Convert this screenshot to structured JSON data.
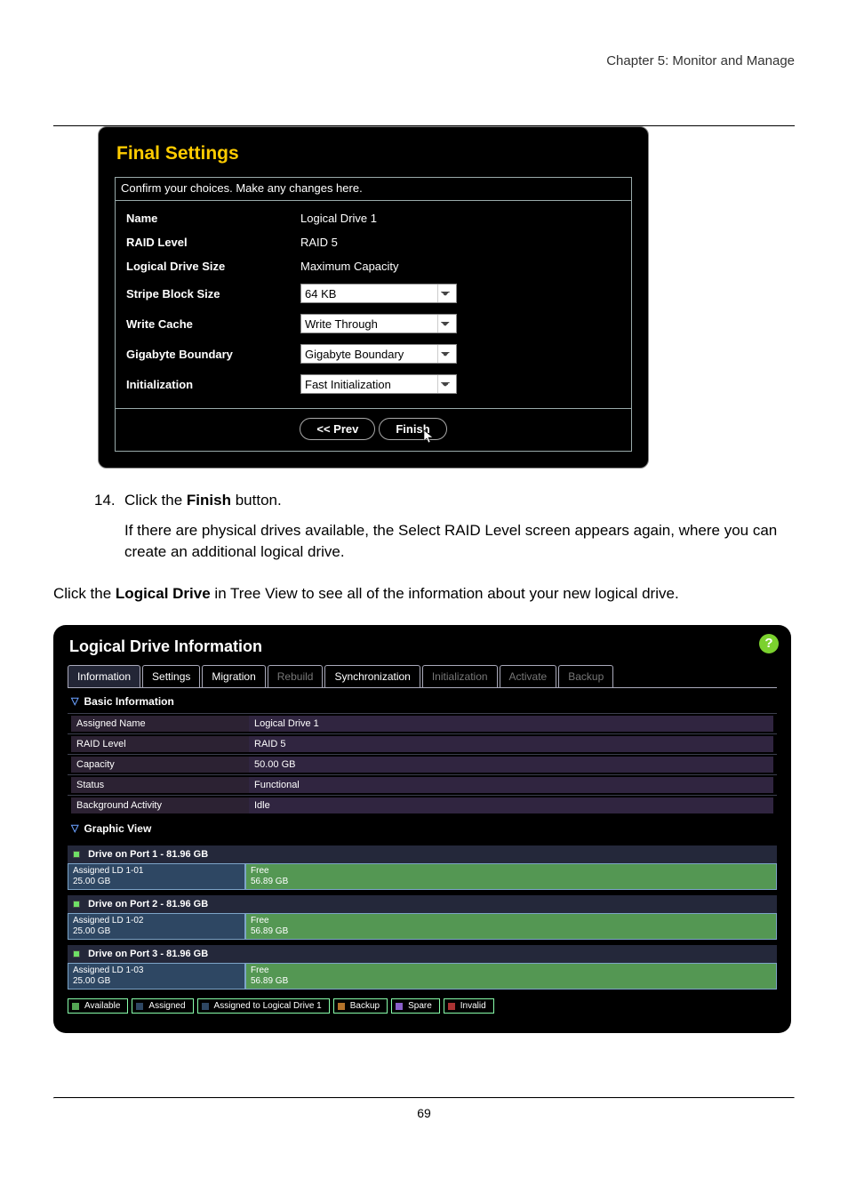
{
  "header": {
    "chapter": "Chapter 5: Monitor and Manage"
  },
  "figure1": {
    "title": "Final Settings",
    "instructions": "Confirm your choices. Make any changes here.",
    "rows": {
      "name_label": "Name",
      "name_value": "Logical Drive 1",
      "raid_label": "RAID Level",
      "raid_value": "RAID 5",
      "size_label": "Logical Drive Size",
      "size_value": "Maximum Capacity",
      "stripe_label": "Stripe Block Size",
      "stripe_value": "64 KB",
      "cache_label": "Write Cache",
      "cache_value": "Write Through",
      "gb_label": "Gigabyte Boundary",
      "gb_value": "Gigabyte Boundary",
      "init_label": "Initialization",
      "init_value": "Fast Initialization"
    },
    "buttons": {
      "prev": "<< Prev",
      "finish": "Finish"
    }
  },
  "step": {
    "num": "14.",
    "text_prefix": "Click the ",
    "text_bold": "Finish",
    "text_suffix": " button.",
    "sub": "If there are physical drives available, the Select RAID Level screen appears again, where you can create an additional logical drive."
  },
  "para": {
    "prefix": "Click the ",
    "bold": "Logical Drive",
    "suffix": " in Tree View to see all of the information about your new logical drive."
  },
  "figure2": {
    "title": "Logical Drive Information",
    "help": "?",
    "tabs": {
      "information": "Information",
      "settings": "Settings",
      "migration": "Migration",
      "rebuild": "Rebuild",
      "synchronization": "Synchronization",
      "initialization": "Initialization",
      "activate": "Activate",
      "backup": "Backup"
    },
    "section_basic": "Basic Information",
    "info": [
      {
        "k": "Assigned Name",
        "v": "Logical Drive 1"
      },
      {
        "k": "RAID Level",
        "v": "RAID 5"
      },
      {
        "k": "Capacity",
        "v": "50.00 GB"
      },
      {
        "k": "Status",
        "v": "Functional"
      },
      {
        "k": "Background Activity",
        "v": "Idle"
      }
    ],
    "section_graphic": "Graphic View",
    "drives": [
      {
        "head": "Drive on Port 1 - 81.96 GB",
        "assigned_line1": "Assigned LD 1-01",
        "assigned_line2": "25.00 GB",
        "free_line1": "Free",
        "free_line2": "56.89 GB"
      },
      {
        "head": "Drive on Port 2 - 81.96 GB",
        "assigned_line1": "Assigned LD 1-02",
        "assigned_line2": "25.00 GB",
        "free_line1": "Free",
        "free_line2": "56.89 GB"
      },
      {
        "head": "Drive on Port 3 - 81.96 GB",
        "assigned_line1": "Assigned LD 1-03",
        "assigned_line2": "25.00 GB",
        "free_line1": "Free",
        "free_line2": "56.89 GB"
      }
    ],
    "legend": {
      "available": "Available",
      "assigned": "Assigned",
      "assigned_ld1": "Assigned to Logical Drive 1",
      "backup": "Backup",
      "spare": "Spare",
      "invalid": "Invalid"
    }
  },
  "footer": {
    "page": "69"
  }
}
